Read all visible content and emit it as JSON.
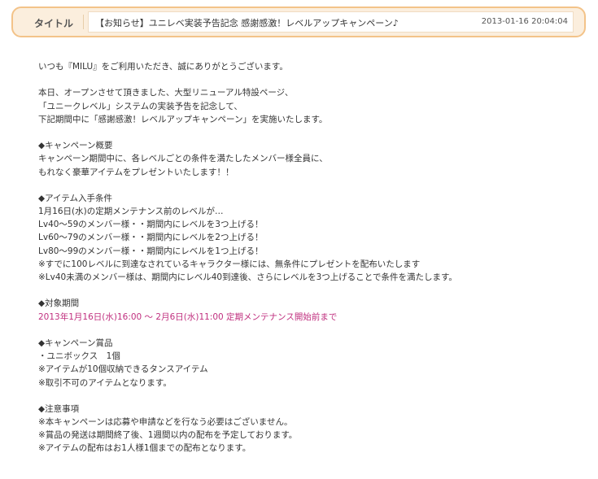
{
  "header": {
    "label": "タイトル",
    "title": "【お知らせ】ユニレベ実装予告記念 感謝感激！レベルアップキャンペーン♪",
    "date": "2013-01-16 20:04:04"
  },
  "body": {
    "lines": [
      {
        "text": "いつも『MILU』をご利用いただき、誠にありがとうございます。"
      },
      {
        "text": ""
      },
      {
        "text": "本日、オープンさせて頂きました、大型リニューアル特設ページ、"
      },
      {
        "text": "「ユニークレベル」システムの実装予告を記念して、"
      },
      {
        "text": "下記期間中に「感謝感激！レベルアップキャンペーン」を実施いたします。"
      },
      {
        "text": ""
      },
      {
        "text": "◆キャンペーン概要"
      },
      {
        "text": "キャンペーン期間中に、各レベルごとの条件を満たしたメンバー様全員に、"
      },
      {
        "text": "もれなく豪華アイテムをプレゼントいたします！！"
      },
      {
        "text": ""
      },
      {
        "text": "◆アイテム入手条件"
      },
      {
        "text": "1月16日(水)の定期メンテナンス前のレベルが…"
      },
      {
        "text": " Lv40〜59のメンバー様・・期間内にレベルを3つ上げる！"
      },
      {
        "text": " Lv60〜79のメンバー様・・期間内にレベルを2つ上げる！"
      },
      {
        "text": " Lv80〜99のメンバー様・・期間内にレベルを1つ上げる！"
      },
      {
        "text": "※すでに100レベルに到達なされているキャラクター様には、無条件にプレゼントを配布いたします"
      },
      {
        "text": "※Lv40未満のメンバー様は、期間内にレベル40到達後、さらにレベルを3つ上げることで条件を満たします。"
      },
      {
        "text": ""
      },
      {
        "text": "◆対象期間"
      },
      {
        "text": "2013年1月16日(水)16:00 〜 2月6日(水)11:00 定期メンテナンス開始前まで",
        "style": "pink"
      },
      {
        "text": ""
      },
      {
        "text": "◆キャンペーン賞品"
      },
      {
        "text": "・ユニボックス　1個"
      },
      {
        "text": "※アイテムが10個収納できるタンスアイテム"
      },
      {
        "text": "※取引不可のアイテムとなります。"
      },
      {
        "text": ""
      },
      {
        "text": "◆注意事項"
      },
      {
        "text": "※本キャンペーンは応募や申請などを行なう必要はございません。"
      },
      {
        "text": "※賞品の発送は期間終了後、1週間以内の配布を予定しております。"
      },
      {
        "text": "※アイテムの配布はお1人様1個までの配布となります。"
      }
    ]
  }
}
